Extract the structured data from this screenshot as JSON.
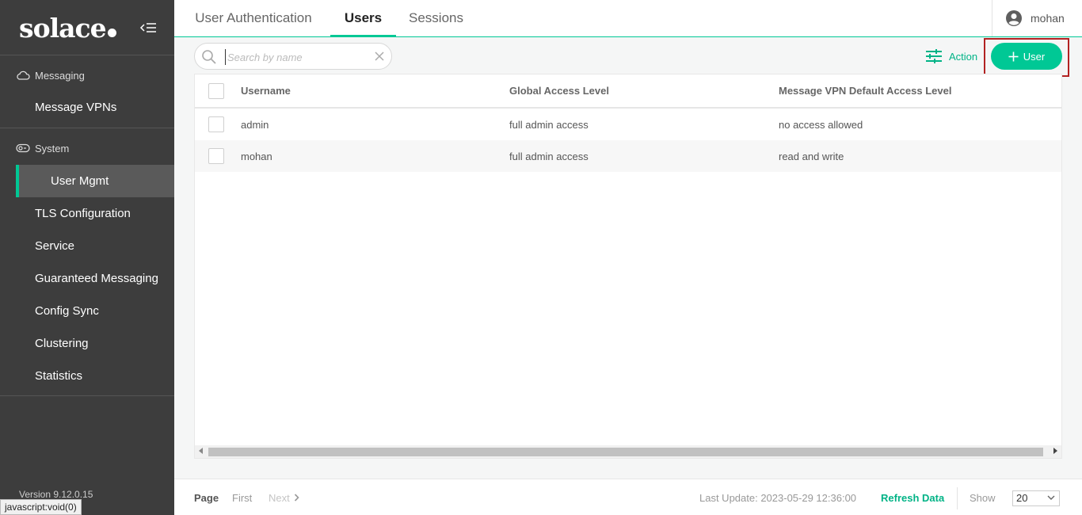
{
  "sidebar": {
    "logo": "solace",
    "sections": [
      {
        "title": "Messaging",
        "icon": "cloud-icon",
        "items": [
          "Message VPNs"
        ]
      },
      {
        "title": "System",
        "icon": "toggle-icon",
        "items": [
          "User Mgmt",
          "TLS Configuration",
          "Service",
          "Guaranteed Messaging",
          "Config Sync",
          "Clustering",
          "Statistics"
        ]
      }
    ],
    "active_item": "User Mgmt",
    "version": "Version 9.12.0.15"
  },
  "status_bar": "javascript:void(0)",
  "tabs": [
    "User Authentication",
    "Users",
    "Sessions"
  ],
  "active_tab": "Users",
  "user": {
    "name": "mohan"
  },
  "toolbar": {
    "search_placeholder": "Search by name",
    "action_label": "Action",
    "add_user_label": "User"
  },
  "table": {
    "columns": [
      "Username",
      "Global Access Level",
      "Message VPN Default Access Level"
    ],
    "rows": [
      [
        "admin",
        "full admin access",
        "no access allowed"
      ],
      [
        "mohan",
        "full admin access",
        "read and write"
      ]
    ]
  },
  "footer": {
    "page_label": "Page",
    "first_label": "First",
    "next_label": "Next",
    "last_update": "Last Update: 2023-05-29 12:36:00",
    "refresh_label": "Refresh Data",
    "show_label": "Show",
    "show_value": "20"
  },
  "colors": {
    "accent": "#00c895",
    "sidebar_bg": "#3d3d3d",
    "highlight_border": "#b22222"
  }
}
